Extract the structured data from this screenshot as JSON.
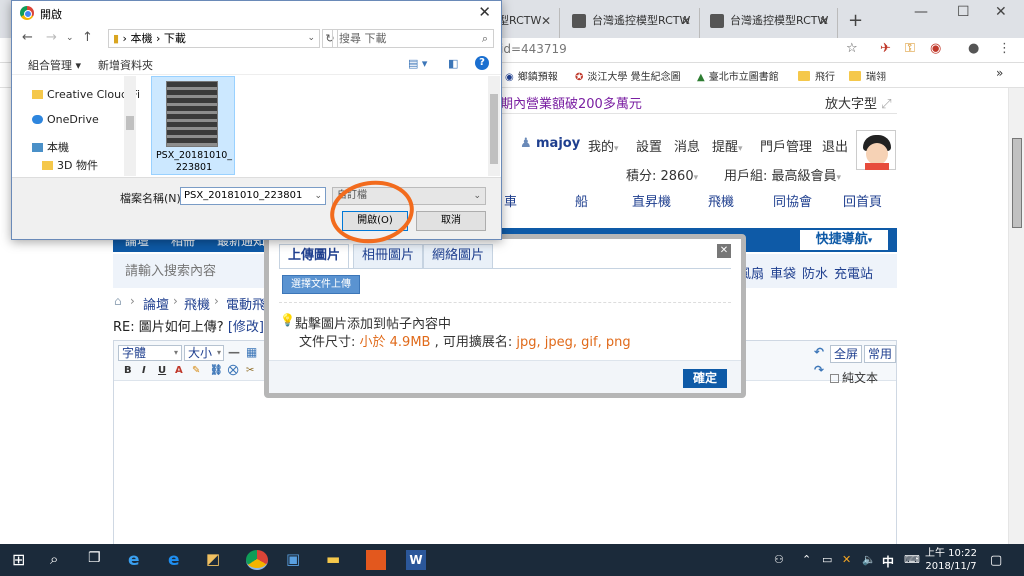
{
  "browser": {
    "tabs": [
      {
        "label": "型RCTW"
      },
      {
        "label": "台灣遙控模型RCTW"
      },
      {
        "label": "台灣遙控模型RCTW"
      }
    ],
    "url_fragment": "id=443719",
    "bookmarks": [
      "鄉鎮預報",
      "淡江大學 覺生紀念圖",
      "臺北市立圖書館",
      "飛行",
      "瑞翎"
    ],
    "overflow_label": "»"
  },
  "site": {
    "promo_text": "期內營業額破200多萬元",
    "bigfont_label": "放大字型",
    "user": {
      "name": "majoy",
      "links": [
        "我的",
        "設置",
        "消息",
        "提醒",
        "門戶管理",
        "退出"
      ],
      "points_label": "積分: 2860",
      "group_label": "用戶組: 最高級會員"
    },
    "categories": [
      "車",
      "船",
      "直昇機",
      "飛機",
      "同協會",
      "回首頁"
    ],
    "bluebar_items": [
      "論壇",
      "相冊",
      "最新通知"
    ],
    "quicknav_label": "快捷導航",
    "search_placeholder": "請輸入搜索內容",
    "hot_keywords": [
      "風扇",
      "車袋",
      "防水",
      "充電站"
    ],
    "breadcrumb": [
      "論壇",
      "飛機",
      "電動飛機"
    ],
    "reply_title": "RE: 圖片如何上傳?",
    "edit_link": "[修改]",
    "editor": {
      "font_select": "字體",
      "size_select": "大小",
      "format_buttons": [
        "B",
        "I",
        "U",
        "A"
      ],
      "fullscreen": "全屏",
      "common": "常用",
      "plaintext": "純文本"
    }
  },
  "upload_popup": {
    "tabs": [
      "上傳圖片",
      "相冊圖片",
      "網絡圖片"
    ],
    "choose_button": "選擇文件上傳",
    "hint": "點擊圖片添加到帖子內容中",
    "size_prefix": "文件尺寸: ",
    "size_value": "小於 4.9MB",
    "ext_prefix": " , 可用擴展名: ",
    "ext_value": "jpg, jpeg, gif, png",
    "ok_button": "確定"
  },
  "file_dialog": {
    "title": "開啟",
    "path": [
      "本機",
      "下載"
    ],
    "search_placeholder": "搜尋 下載",
    "commands": [
      "組合管理 ▾",
      "新增資料夾"
    ],
    "tree": [
      "Creative Cloud Fi",
      "OneDrive",
      "本機",
      "3D 物件"
    ],
    "file": {
      "name": "PSX_20181010_223801"
    },
    "filename_label": "檔案名稱(N):",
    "filename_value": "PSX_20181010_223801",
    "filetype_value": "自訂檔",
    "open_button": "開啟(O)",
    "cancel_button": "取消"
  },
  "taskbar": {
    "tray_ime": "中",
    "time": "上午 10:22",
    "date": "2018/11/7"
  },
  "colors": {
    "brand_blue": "#0e5aa7",
    "highlight_circle": "#f26b1d",
    "size_red": "#e06a1a"
  }
}
